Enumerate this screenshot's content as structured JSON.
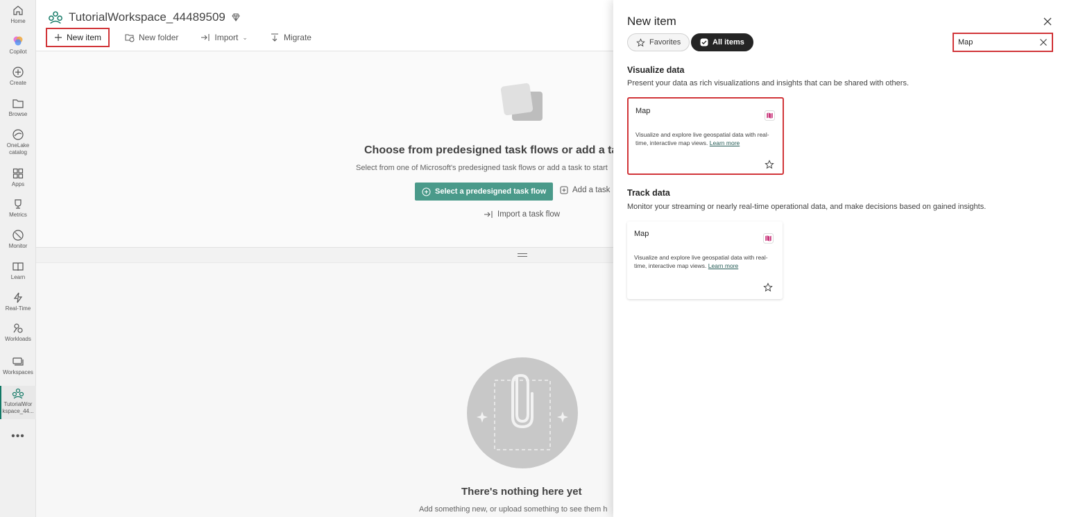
{
  "rail": {
    "items": [
      {
        "label": "Home",
        "icon": "home-icon"
      },
      {
        "label": "Copilot",
        "icon": "copilot-icon"
      },
      {
        "label": "Create",
        "icon": "plus-circle-icon"
      },
      {
        "label": "Browse",
        "icon": "folder-icon"
      },
      {
        "label": "OneLake catalog",
        "icon": "onelake-icon"
      },
      {
        "label": "Apps",
        "icon": "apps-icon"
      },
      {
        "label": "Metrics",
        "icon": "trophy-icon"
      },
      {
        "label": "Monitor",
        "icon": "monitor-icon"
      },
      {
        "label": "Learn",
        "icon": "book-icon"
      },
      {
        "label": "Real-Time",
        "icon": "lightning-icon"
      },
      {
        "label": "Workloads",
        "icon": "workloads-icon"
      },
      {
        "label": "Workspaces",
        "icon": "workspaces-icon"
      },
      {
        "label": "TutorialWorkspace_44...",
        "label_line1": "TutorialWor",
        "label_line2": "kspace_44...",
        "icon": "workspace-icon"
      }
    ],
    "more_label": "•••"
  },
  "workspace": {
    "title": "TutorialWorkspace_44489509",
    "toolbar": {
      "new_item": "New item",
      "new_folder": "New folder",
      "import": "Import",
      "migrate": "Migrate"
    },
    "taskflow": {
      "heading": "Choose from predesigned task flows or add a task",
      "subtext": "Select from one of Microsoft's predesigned task flows or add a task to start",
      "primary_button": "Select a predesigned task flow",
      "add_task": "Add a task",
      "import_task_flow": "Import a task flow"
    },
    "empty": {
      "title": "There's nothing here yet",
      "subtext": "Add something new, or upload something to see them h"
    }
  },
  "panel": {
    "title": "New item",
    "filters": {
      "favorites": "Favorites",
      "all_items": "All items"
    },
    "search": {
      "value": "Map"
    },
    "sections": [
      {
        "title": "Visualize data",
        "description": "Present your data as rich visualizations and insights that can be shared with others.",
        "card": {
          "title": "Map",
          "description": "Visualize and explore live geospatial data with real-time, interactive map views.",
          "link": "Learn more"
        }
      },
      {
        "title": "Track data",
        "description": "Monitor your streaming or nearly real-time operational data, and make decisions based on gained insights.",
        "card": {
          "title": "Map",
          "description": "Visualize and explore live geospatial data with real-time, interactive map views.",
          "link": "Learn more"
        }
      }
    ]
  },
  "colors": {
    "accent": "#117865",
    "primary_button": "#4a9a8a",
    "highlight": "#d13438",
    "map_icon": "#c8357a"
  }
}
